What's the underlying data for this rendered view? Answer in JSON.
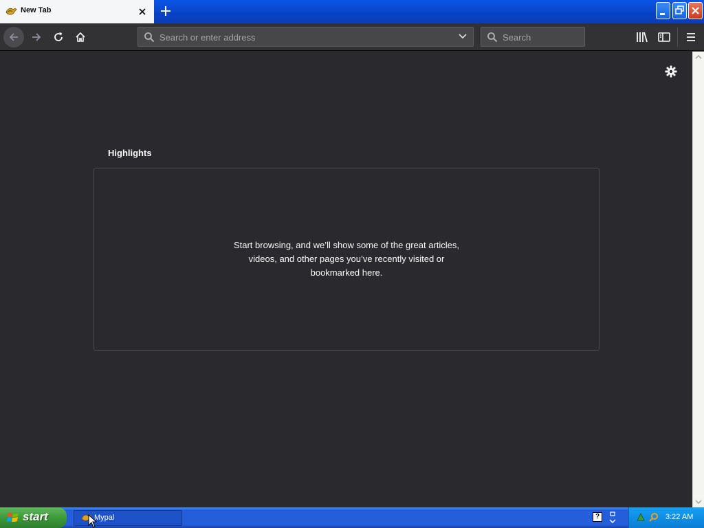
{
  "tabstrip": {
    "tab_title": "New Tab"
  },
  "toolbar": {
    "url_placeholder": "Search or enter address",
    "search_placeholder": "Search"
  },
  "content": {
    "section_title": "Highlights",
    "empty_message": "Start browsing, and we’ll show some of the great articles, videos, and other pages you’ve recently visited or bookmarked here."
  },
  "taskbar": {
    "start_label": "start",
    "task_label": "Mypal",
    "help_glyph": "?",
    "clock": "3:22 AM"
  },
  "colors": {
    "content_bg": "#2a2a2e",
    "toolbar_bg": "#323234",
    "taskbar_blue": "#245edb",
    "start_green": "#3c9a3a"
  }
}
